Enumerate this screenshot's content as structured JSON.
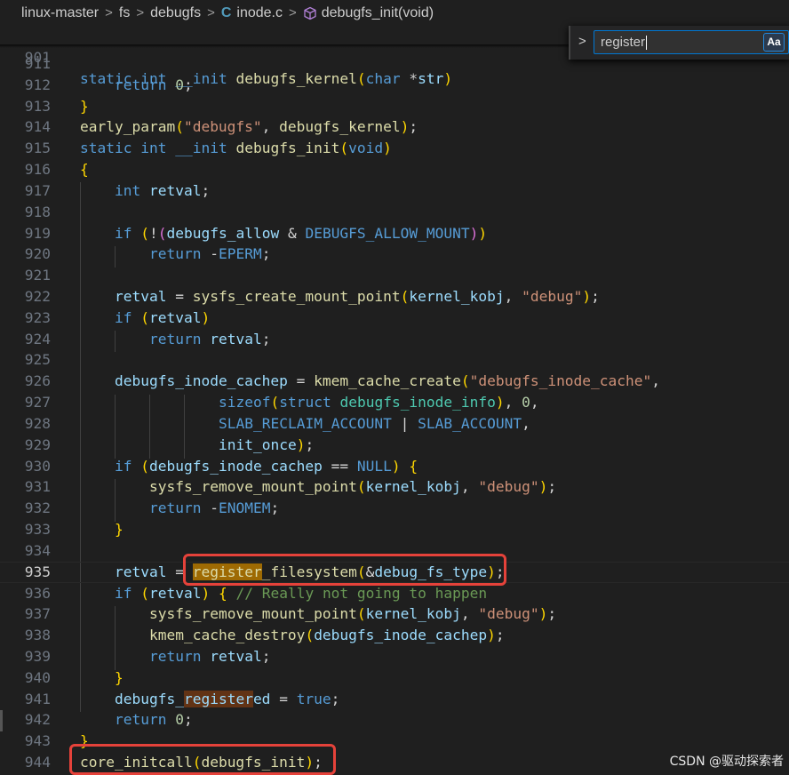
{
  "breadcrumb": {
    "items": [
      "linux-master",
      "fs",
      "debugfs",
      "inode.c",
      "debugfs_init(void)"
    ],
    "file_icon": "C"
  },
  "find_widget": {
    "value": "register",
    "match_case_label": "Aa"
  },
  "sticky": {
    "line_number": "901",
    "text": "static int __init debugfs_kernel(char *str)"
  },
  "lines": [
    {
      "n": "911",
      "t": ""
    },
    {
      "n": "912",
      "t": "    return 0;"
    },
    {
      "n": "913",
      "t": "}"
    },
    {
      "n": "914",
      "t": "early_param(\"debugfs\", debugfs_kernel);"
    },
    {
      "n": "915",
      "t": "static int __init debugfs_init(void)"
    },
    {
      "n": "916",
      "t": "{"
    },
    {
      "n": "917",
      "t": "    int retval;"
    },
    {
      "n": "918",
      "t": ""
    },
    {
      "n": "919",
      "t": "    if (!(debugfs_allow & DEBUGFS_ALLOW_MOUNT))"
    },
    {
      "n": "920",
      "t": "        return -EPERM;"
    },
    {
      "n": "921",
      "t": ""
    },
    {
      "n": "922",
      "t": "    retval = sysfs_create_mount_point(kernel_kobj, \"debug\");"
    },
    {
      "n": "923",
      "t": "    if (retval)"
    },
    {
      "n": "924",
      "t": "        return retval;"
    },
    {
      "n": "925",
      "t": ""
    },
    {
      "n": "926",
      "t": "    debugfs_inode_cachep = kmem_cache_create(\"debugfs_inode_cache\","
    },
    {
      "n": "927",
      "t": "                sizeof(struct debugfs_inode_info), 0,"
    },
    {
      "n": "928",
      "t": "                SLAB_RECLAIM_ACCOUNT | SLAB_ACCOUNT,"
    },
    {
      "n": "929",
      "t": "                init_once);"
    },
    {
      "n": "930",
      "t": "    if (debugfs_inode_cachep == NULL) {"
    },
    {
      "n": "931",
      "t": "        sysfs_remove_mount_point(kernel_kobj, \"debug\");"
    },
    {
      "n": "932",
      "t": "        return -ENOMEM;"
    },
    {
      "n": "933",
      "t": "    }"
    },
    {
      "n": "934",
      "t": ""
    },
    {
      "n": "935",
      "t": "    retval = register_filesystem(&debug_fs_type);"
    },
    {
      "n": "936",
      "t": "    if (retval) { // Really not going to happen"
    },
    {
      "n": "937",
      "t": "        sysfs_remove_mount_point(kernel_kobj, \"debug\");"
    },
    {
      "n": "938",
      "t": "        kmem_cache_destroy(debugfs_inode_cachep);"
    },
    {
      "n": "939",
      "t": "        return retval;"
    },
    {
      "n": "940",
      "t": "    }"
    },
    {
      "n": "941",
      "t": "    debugfs_registered = true;"
    },
    {
      "n": "942",
      "t": "    return 0;"
    },
    {
      "n": "943",
      "t": "}"
    },
    {
      "n": "944",
      "t": "core_initcall(debugfs_init);"
    }
  ],
  "active_line": "935",
  "search_term": "register",
  "watermark": "CSDN @驱动探索者",
  "colors": {
    "background": "#1f1f1f",
    "keyword": "#569cd6",
    "function": "#dcdcaa",
    "variable": "#9cdcfe",
    "string": "#ce9178",
    "comment": "#6a9955",
    "number": "#b5cea8",
    "annotation_box": "#e5423a",
    "find_match": "#9e6a03"
  }
}
